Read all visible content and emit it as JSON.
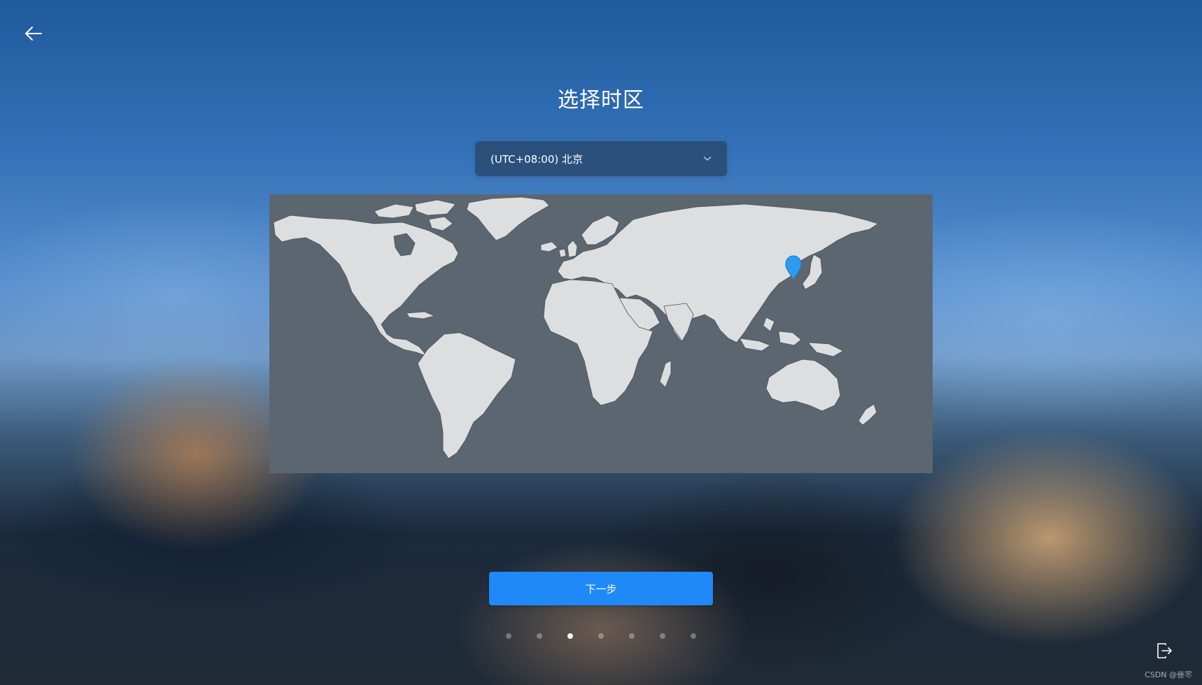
{
  "header": {
    "back_icon": "arrow-left-icon",
    "title": "选择时区"
  },
  "timezone": {
    "selected": "(UTC+08:00) 北京",
    "dropdown_icon": "chevron-down-icon"
  },
  "map": {
    "marker_icon": "location-pin-icon",
    "marker_color": "#2d9bf0",
    "ocean_color": "#5c6670",
    "land_color": "#dcdee0"
  },
  "footer": {
    "next_label": "下一步",
    "steps_total": 7,
    "current_step": 3,
    "exit_icon": "exit-icon"
  },
  "watermark": "CSDN @卌罖",
  "colors": {
    "accent": "#2089f8"
  }
}
